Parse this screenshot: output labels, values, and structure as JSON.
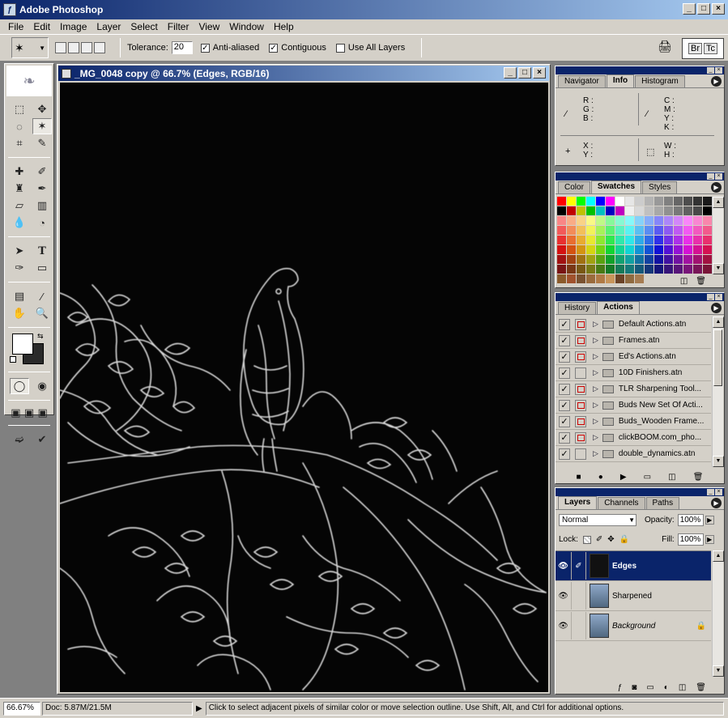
{
  "window": {
    "title": "Adobe Photoshop",
    "min": "_",
    "max": "□",
    "close": "×"
  },
  "menu": [
    "File",
    "Edit",
    "Image",
    "Layer",
    "Select",
    "Filter",
    "View",
    "Window",
    "Help"
  ],
  "options": {
    "tolerance_label": "Tolerance:",
    "tolerance_value": "20",
    "anti_aliased": "Anti-aliased",
    "contiguous": "Contiguous",
    "use_all_layers": "Use All Layers",
    "check": "✓",
    "palette_well": [
      "Br",
      "Tc"
    ]
  },
  "document": {
    "title": "_MG_0048 copy @ 66.7% (Edges, RGB/16)"
  },
  "info_panel": {
    "tabs": [
      "Navigator",
      "Info",
      "Histogram"
    ],
    "active_tab": "Info",
    "rgb": [
      "R :",
      "G :",
      "B :"
    ],
    "cmyk": [
      "C :",
      "M :",
      "Y :",
      "K :"
    ],
    "xy": [
      "X :",
      "Y :"
    ],
    "wh": [
      "W :",
      "H :"
    ]
  },
  "swatches_panel": {
    "tabs": [
      "Color",
      "Swatches",
      "Styles"
    ],
    "active_tab": "Swatches"
  },
  "actions_panel": {
    "tabs": [
      "History",
      "Actions"
    ],
    "active_tab": "Actions",
    "items": [
      {
        "name": "Default Actions.atn",
        "dialog": true
      },
      {
        "name": "Frames.atn",
        "dialog": true
      },
      {
        "name": "Ed's Actions.atn",
        "dialog": true
      },
      {
        "name": "10D Finishers.atn",
        "dialog": false
      },
      {
        "name": "TLR Sharpening Tool...",
        "dialog": true
      },
      {
        "name": "Buds New Set Of Acti...",
        "dialog": true
      },
      {
        "name": "Buds_Wooden Frame...",
        "dialog": true
      },
      {
        "name": "clickBOOM.com_pho...",
        "dialog": true
      },
      {
        "name": "double_dynamics.atn",
        "dialog": false
      }
    ]
  },
  "layers_panel": {
    "tabs": [
      "Layers",
      "Channels",
      "Paths"
    ],
    "active_tab": "Layers",
    "blend_mode": "Normal",
    "opacity_label": "Opacity:",
    "opacity": "100%",
    "lock_label": "Lock:",
    "fill_label": "Fill:",
    "fill": "100%",
    "layers": [
      {
        "name": "Edges",
        "active": true
      },
      {
        "name": "Sharpened",
        "active": false
      },
      {
        "name": "Background",
        "active": false,
        "italic": true,
        "locked": true
      }
    ]
  },
  "status": {
    "zoom": "66.67%",
    "doc": "Doc: 5.87M/21.5M",
    "hint": "Click to select adjacent pixels of similar color or move selection outline.  Use Shift, Alt, and Ctrl for additional options."
  }
}
